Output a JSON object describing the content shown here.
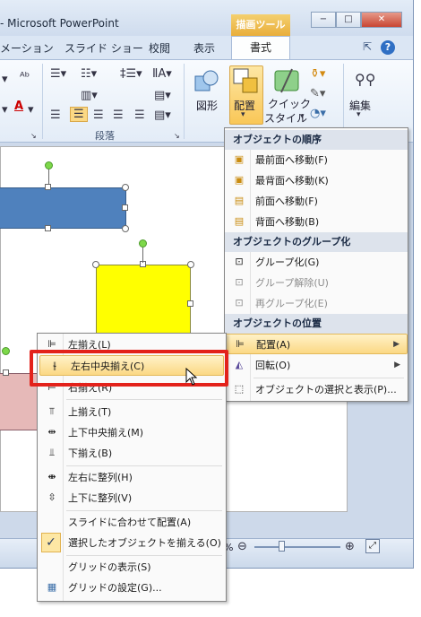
{
  "window": {
    "title": "- Microsoft PowerPoint",
    "context_tab_title": "描画ツール",
    "controls": [
      "−",
      "□",
      "✕"
    ]
  },
  "tabs": {
    "items": [
      {
        "label": "メーション"
      },
      {
        "label": "スライド ショー"
      },
      {
        "label": "校閲"
      },
      {
        "label": "表示"
      }
    ],
    "format_tab": "書式"
  },
  "ribbon": {
    "paragraph_group_label": "段落",
    "shape_label": "図形",
    "arrange_label": "配置",
    "quick_style_label_1": "クイック",
    "quick_style_label_2": "スタイル",
    "edit_label": "編集"
  },
  "arrange_menu": {
    "header_order": "オブジェクトの順序",
    "bring_front": "最前面へ移動(F)",
    "send_back": "最背面へ移動(K)",
    "bring_forward": "前面へ移動(F)",
    "send_backward": "背面へ移動(B)",
    "header_group": "オブジェクトのグループ化",
    "group": "グループ化(G)",
    "ungroup": "グループ解除(U)",
    "regroup": "再グループ化(E)",
    "header_position": "オブジェクトの位置",
    "align": "配置(A)",
    "rotate": "回転(O)",
    "selection_pane": "オブジェクトの選択と表示(P)..."
  },
  "align_menu": {
    "align_left": "左揃え(L)",
    "align_center": "左右中央揃え(C)",
    "align_right": "右揃え(R)",
    "align_top": "上揃え(T)",
    "align_middle": "上下中央揃え(M)",
    "align_bottom": "下揃え(B)",
    "distribute_h": "左右に整列(H)",
    "distribute_v": "上下に整列(V)",
    "align_to_slide": "スライドに合わせて配置(A)",
    "align_selected": "選択したオブジェクトを揃える(O)",
    "show_grid": "グリッドの表示(S)",
    "grid_settings": "グリッドの設定(G)..."
  },
  "status": {
    "zoom_fragment": "%"
  },
  "colors": {
    "blue_shape": "#4f81bd",
    "yellow_shape": "#ffff00",
    "pink_shape": "#e6b9b8",
    "highlight_red": "#e3221b",
    "menu_hover": "#fbd884"
  }
}
